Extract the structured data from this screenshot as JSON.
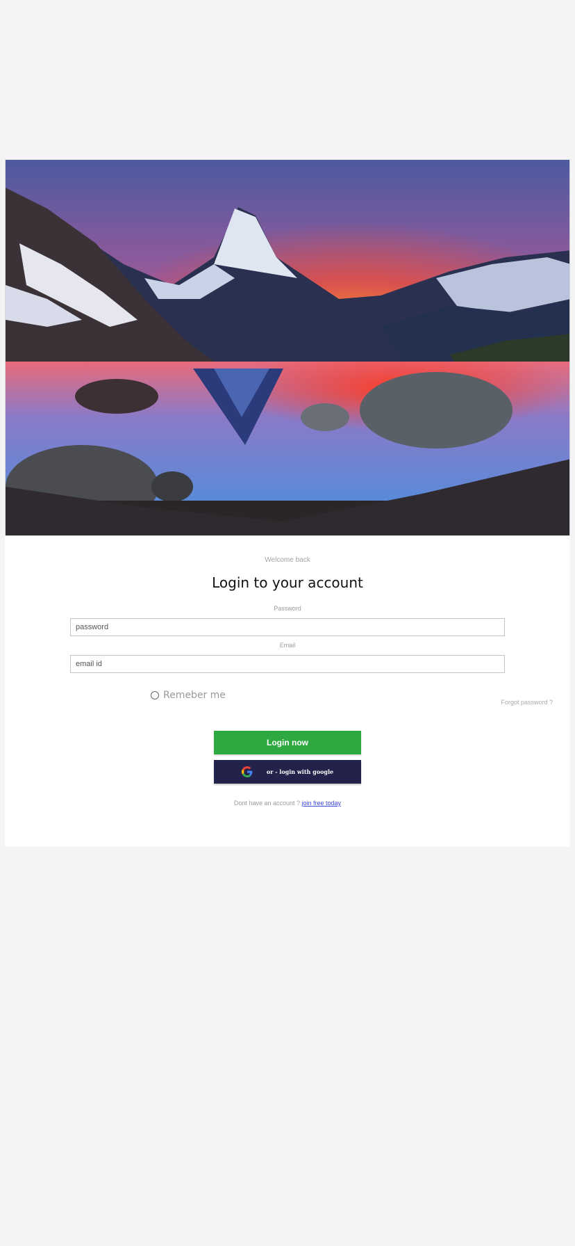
{
  "hero": {
    "image": "mountain-lake-sunset"
  },
  "login": {
    "welcome": "Welcome back",
    "title": "Login to your account",
    "password_label": "Password",
    "password_placeholder": "password",
    "email_label": "Email",
    "email_placeholder": "email id",
    "remember_label": "Remeber me",
    "forgot_link": "Forgot password ?",
    "login_button": "Login now",
    "google_button": "or - login with google",
    "signup_prompt": "Dont have an account ?",
    "signup_link": "join free today"
  },
  "colors": {
    "background": "#f4f4f4",
    "login_button": "#2ea840",
    "google_button": "#23224a",
    "link": "#3b49d8"
  },
  "icons": {
    "google": "google-icon",
    "radio": "radio-icon"
  }
}
